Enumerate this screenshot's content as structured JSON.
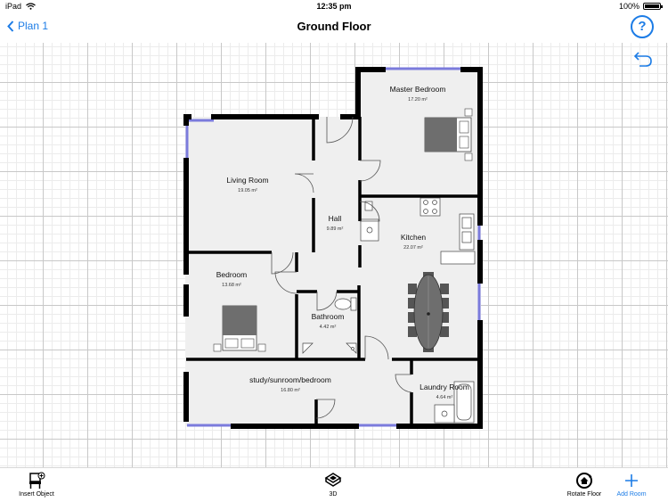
{
  "status_bar": {
    "device": "iPad",
    "time": "12:35 pm",
    "battery": "100%",
    "battery_level": 1.0
  },
  "nav": {
    "back_label": "Plan 1",
    "title": "Ground Floor",
    "help_label": "?"
  },
  "rooms": [
    {
      "name": "Master Bedroom",
      "area": "17.20 m²"
    },
    {
      "name": "Living Room",
      "area": "19.05 m²"
    },
    {
      "name": "Hall",
      "area": "9.89 m²"
    },
    {
      "name": "Kitchen",
      "area": "22.07 m²"
    },
    {
      "name": "Bedroom",
      "area": "13.68 m²"
    },
    {
      "name": "Bathroom",
      "area": "4.42 m²"
    },
    {
      "name": "study/sunroom/bedroom",
      "area": "16.80 m²"
    },
    {
      "name": "Laundry Room",
      "area": "4.64 m²"
    }
  ],
  "toolbar": {
    "insert_object": "Insert Object",
    "view_3d": "3D",
    "rotate_floor": "Rotate Floor",
    "add_room": "Add Room"
  },
  "colors": {
    "accent": "#1c7ce6",
    "wall": "#000000",
    "window": "#7b7bdc",
    "floor": "#f0f0f0"
  },
  "icons": [
    "wifi-icon",
    "chevron-left-icon",
    "help-icon",
    "undo-icon",
    "chair-icon",
    "cube-3d-icon",
    "rotate-house-icon",
    "plus-icon"
  ]
}
